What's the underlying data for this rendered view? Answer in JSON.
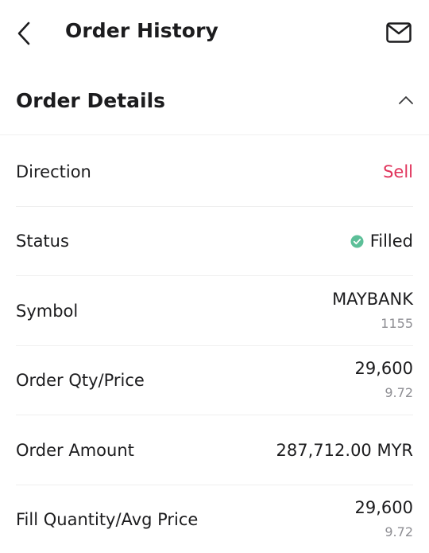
{
  "header": {
    "title": "Order History",
    "back_icon": "chevron-left-icon",
    "mail_icon": "envelope-icon"
  },
  "section": {
    "title": "Order Details",
    "toggle_icon": "chevron-up-icon"
  },
  "rows": {
    "direction": {
      "label": "Direction",
      "value": "Sell",
      "value_color": "#e0335b"
    },
    "status": {
      "label": "Status",
      "value": "Filled",
      "icon": "check-circle-icon",
      "icon_color": "#5cbf98"
    },
    "symbol": {
      "label": "Symbol",
      "primary": "MAYBANK",
      "secondary": "1155"
    },
    "order_qty_price": {
      "label": "Order Qty/Price",
      "primary": "29,600",
      "secondary": "9.72"
    },
    "order_amount": {
      "label": "Order Amount",
      "value": "287,712.00 MYR"
    },
    "fill_qty_avg_price": {
      "label": "Fill Quantity/Avg Price",
      "primary": "29,600",
      "secondary": "9.72"
    }
  }
}
